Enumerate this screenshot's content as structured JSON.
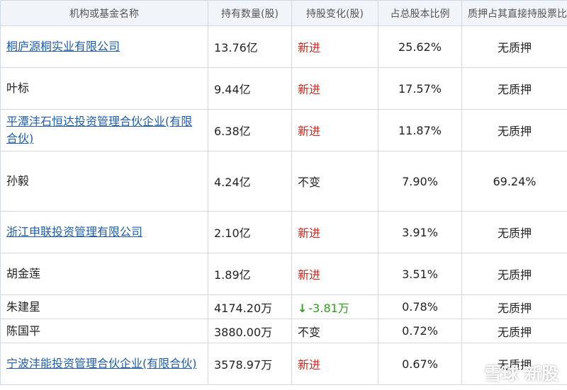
{
  "headers": [
    "机构或基金名称",
    "持有数量(股)",
    "持股变化(股)",
    "占总股本比例",
    "质押占其直接持股票比例"
  ],
  "rows": [
    {
      "name": "桐庐源桐实业有限公司",
      "link": true,
      "qty": "13.76亿",
      "change": "新进",
      "change_type": "new",
      "ratio": "25.62%",
      "pledge": "无质押"
    },
    {
      "name": "叶标",
      "link": false,
      "qty": "9.44亿",
      "change": "新进",
      "change_type": "new",
      "ratio": "17.57%",
      "pledge": "无质押"
    },
    {
      "name": "平潭沣石恒达投资管理合伙企业(有限合伙)",
      "link": true,
      "qty": "6.38亿",
      "change": "新进",
      "change_type": "new",
      "ratio": "11.87%",
      "pledge": "无质押"
    },
    {
      "name": "孙毅",
      "link": false,
      "qty": "4.24亿",
      "change": "不变",
      "change_type": "same",
      "ratio": "7.90%",
      "pledge": "69.24%"
    },
    {
      "name": "浙江申联投资管理有限公司",
      "link": true,
      "qty": "2.10亿",
      "change": "新进",
      "change_type": "new",
      "ratio": "3.91%",
      "pledge": "无质押"
    },
    {
      "name": "胡金莲",
      "link": false,
      "qty": "1.89亿",
      "change": "新进",
      "change_type": "new",
      "ratio": "3.51%",
      "pledge": "无质押"
    },
    {
      "name": "朱建星",
      "link": false,
      "qty": "4174.20万",
      "change": "-3.81万",
      "change_type": "down",
      "ratio": "0.78%",
      "pledge": "无质押"
    },
    {
      "name": "陈国平",
      "link": false,
      "qty": "3880.00万",
      "change": "不变",
      "change_type": "same",
      "ratio": "0.72%",
      "pledge": "无质押"
    },
    {
      "name": "宁波沣能投资管理合伙企业(有限合伙)",
      "link": true,
      "qty": "3578.97万",
      "change": "新进",
      "change_type": "new",
      "ratio": "0.67%",
      "pledge": "无质押"
    }
  ],
  "watermark": "雪球 新股",
  "colors": {
    "link": "#1f5cb0",
    "new": "#d0271f",
    "down": "#2a9d1a",
    "header_bg": "#f1f4f8",
    "border": "#cfd8e3"
  },
  "icons": {
    "down": "arrow-down-icon"
  }
}
